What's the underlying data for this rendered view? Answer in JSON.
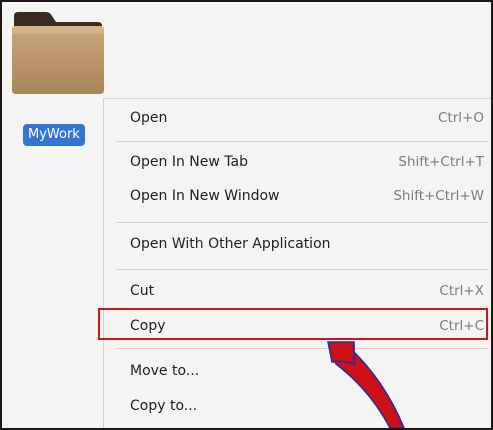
{
  "file": {
    "icon": "folder-icon",
    "label": "MyWork"
  },
  "context_menu": {
    "items": [
      {
        "label": "Open",
        "shortcut": "Ctrl+O"
      },
      {
        "label": "Open In New Tab",
        "shortcut": "Shift+Ctrl+T"
      },
      {
        "label": "Open In New Window",
        "shortcut": "Shift+Ctrl+W"
      },
      {
        "label": "Open With Other Application",
        "shortcut": ""
      },
      {
        "label": "Cut",
        "shortcut": "Ctrl+X"
      },
      {
        "label": "Copy",
        "shortcut": "Ctrl+C"
      },
      {
        "label": "Move to...",
        "shortcut": ""
      },
      {
        "label": "Copy to...",
        "shortcut": ""
      }
    ],
    "highlighted_item": "Copy"
  },
  "colors": {
    "selection": "#3474d4",
    "highlight_box": "#d1131b",
    "arrow_fill": "#cc1016",
    "arrow_outline": "#1b2fa8"
  }
}
